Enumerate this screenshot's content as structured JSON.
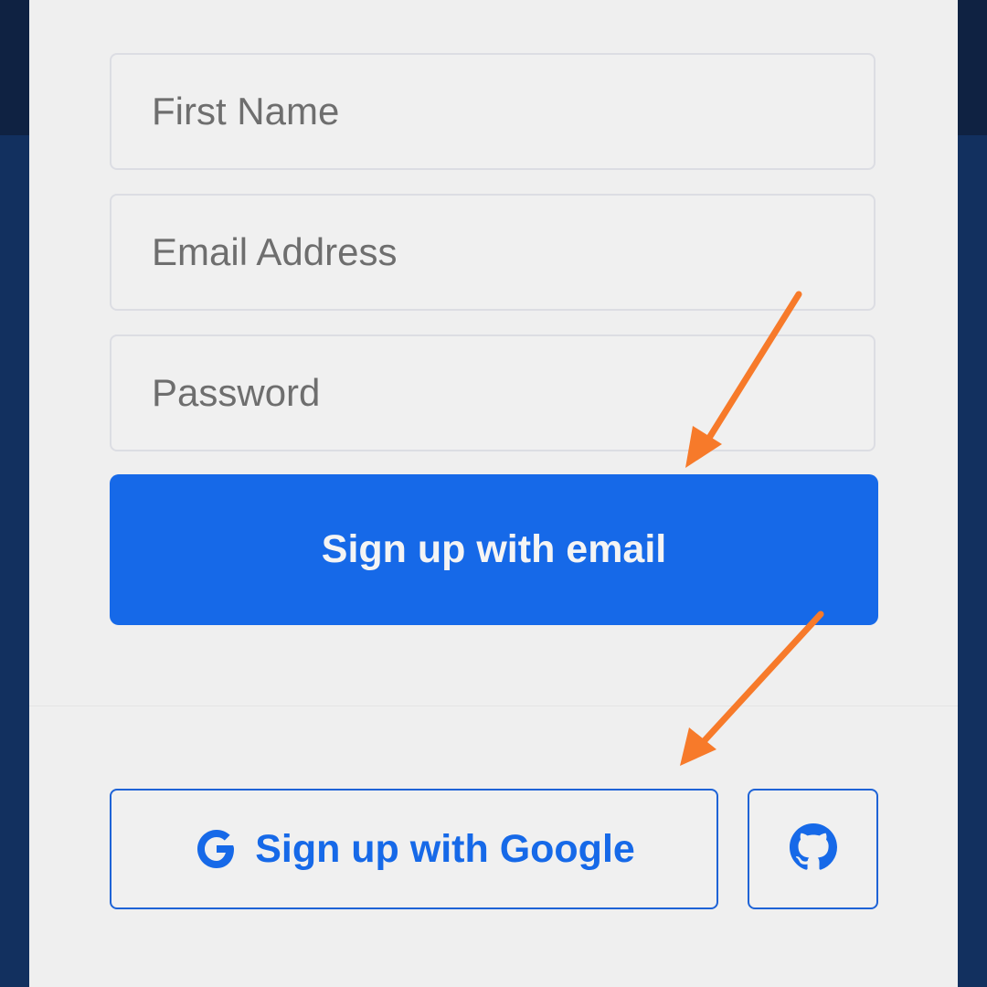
{
  "form": {
    "first_name_placeholder": "First Name",
    "email_placeholder": "Email Address",
    "password_placeholder": "Password",
    "submit_label": "Sign up with email"
  },
  "social": {
    "google_label": "Sign up with Google",
    "google_icon": "google-g-icon",
    "github_icon": "github-icon"
  },
  "colors": {
    "primary": "#1669e8",
    "card_background": "#efefef",
    "page_background": "#102a55",
    "annotation_arrow": "#f77a2a"
  }
}
